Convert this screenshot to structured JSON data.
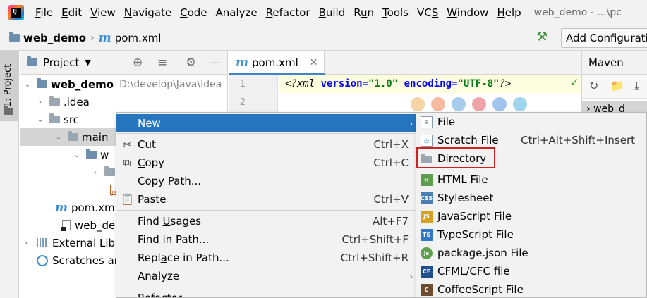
{
  "menubar": {
    "logo_text": "IJ",
    "items": [
      "File",
      "Edit",
      "View",
      "Navigate",
      "Code",
      "Analyze",
      "Refactor",
      "Build",
      "Run",
      "Tools",
      "VCS",
      "Window",
      "Help"
    ],
    "window_title": "web_demo - ...\\pc"
  },
  "navbar": {
    "project": "web_demo",
    "file": "pom.xml",
    "add_config": "Add Configuratio"
  },
  "left_strip": {
    "project_tab": "1: Project"
  },
  "project_panel": {
    "title": "Project",
    "tree": [
      {
        "label": "web_demo",
        "path": "D:\\develop\\Java\\Idea"
      },
      {
        "label": ".idea"
      },
      {
        "label": "src"
      },
      {
        "label": "main"
      },
      {
        "label": "w"
      },
      {
        "label": ""
      },
      {
        "label": ""
      },
      {
        "label": "pom.xm"
      },
      {
        "label": "web_dem"
      },
      {
        "label": "External Libr"
      },
      {
        "label": "Scratches an"
      }
    ]
  },
  "editor": {
    "tab_label": "pom.xml",
    "line_numbers": [
      "1",
      "2"
    ],
    "code": {
      "decl_open": "<?xml ",
      "attr1": "version=",
      "val1": "\"1.0\"",
      "space": " ",
      "attr2": "encoding=",
      "val2": "\"UTF-8\"",
      "decl_close": "?>"
    }
  },
  "maven_panel": {
    "title": "Maven",
    "row": "web_d"
  },
  "context_menu": {
    "items": [
      {
        "label": "New",
        "shortcut": ""
      },
      {
        "label_pre": "Cu",
        "label_ul": "t",
        "label_post": "",
        "shortcut": "Ctrl+X"
      },
      {
        "label_pre": "",
        "label_ul": "C",
        "label_post": "opy",
        "shortcut": "Ctrl+C"
      },
      {
        "label": "Copy Path...",
        "shortcut": ""
      },
      {
        "label_pre": "",
        "label_ul": "P",
        "label_post": "aste",
        "shortcut": "Ctrl+V"
      },
      {
        "label_pre": "Find ",
        "label_ul": "U",
        "label_post": "sages",
        "shortcut": "Alt+F7"
      },
      {
        "label_pre": "Find in ",
        "label_ul": "P",
        "label_post": "ath...",
        "shortcut": "Ctrl+Shift+F"
      },
      {
        "label_pre": "Repl",
        "label_ul": "a",
        "label_post": "ce in Path...",
        "shortcut": "Ctrl+Shift+R"
      },
      {
        "label": "Analyze",
        "shortcut": ""
      },
      {
        "label": "Refactor",
        "shortcut": ""
      }
    ]
  },
  "submenu": {
    "items": [
      {
        "label": "File",
        "shortcut": "",
        "icon": "file-icon",
        "color": "#8a9aa8"
      },
      {
        "label": "Scratch File",
        "shortcut": "Ctrl+Alt+Shift+Insert",
        "icon": "scratch-file-icon",
        "color": "#3b8fd6"
      },
      {
        "label": "Directory",
        "shortcut": "",
        "icon": "directory-icon",
        "color": "#9aa7b0"
      },
      {
        "label": "HTML File",
        "shortcut": "",
        "icon": "html-file-icon",
        "color": "#5e9d4e",
        "badge": "H"
      },
      {
        "label": "Stylesheet",
        "shortcut": "",
        "icon": "stylesheet-icon",
        "color": "#4a7fb5",
        "badge": "CSS"
      },
      {
        "label": "JavaScript File",
        "shortcut": "",
        "icon": "javascript-file-icon",
        "color": "#d6a020",
        "badge": "JS"
      },
      {
        "label": "TypeScript File",
        "shortcut": "",
        "icon": "typescript-file-icon",
        "color": "#3178c6",
        "badge": "TS"
      },
      {
        "label": "package.json File",
        "shortcut": "",
        "icon": "package-json-icon",
        "color": "#5fa04e",
        "badge": "js"
      },
      {
        "label": "CFML/CFC file",
        "shortcut": "",
        "icon": "cfml-file-icon",
        "color": "#1f4f8c",
        "badge": "CF"
      },
      {
        "label": "CoffeeScript File",
        "shortcut": "",
        "icon": "coffeescript-file-icon",
        "color": "#6e4c2e",
        "badge": "C"
      }
    ]
  }
}
